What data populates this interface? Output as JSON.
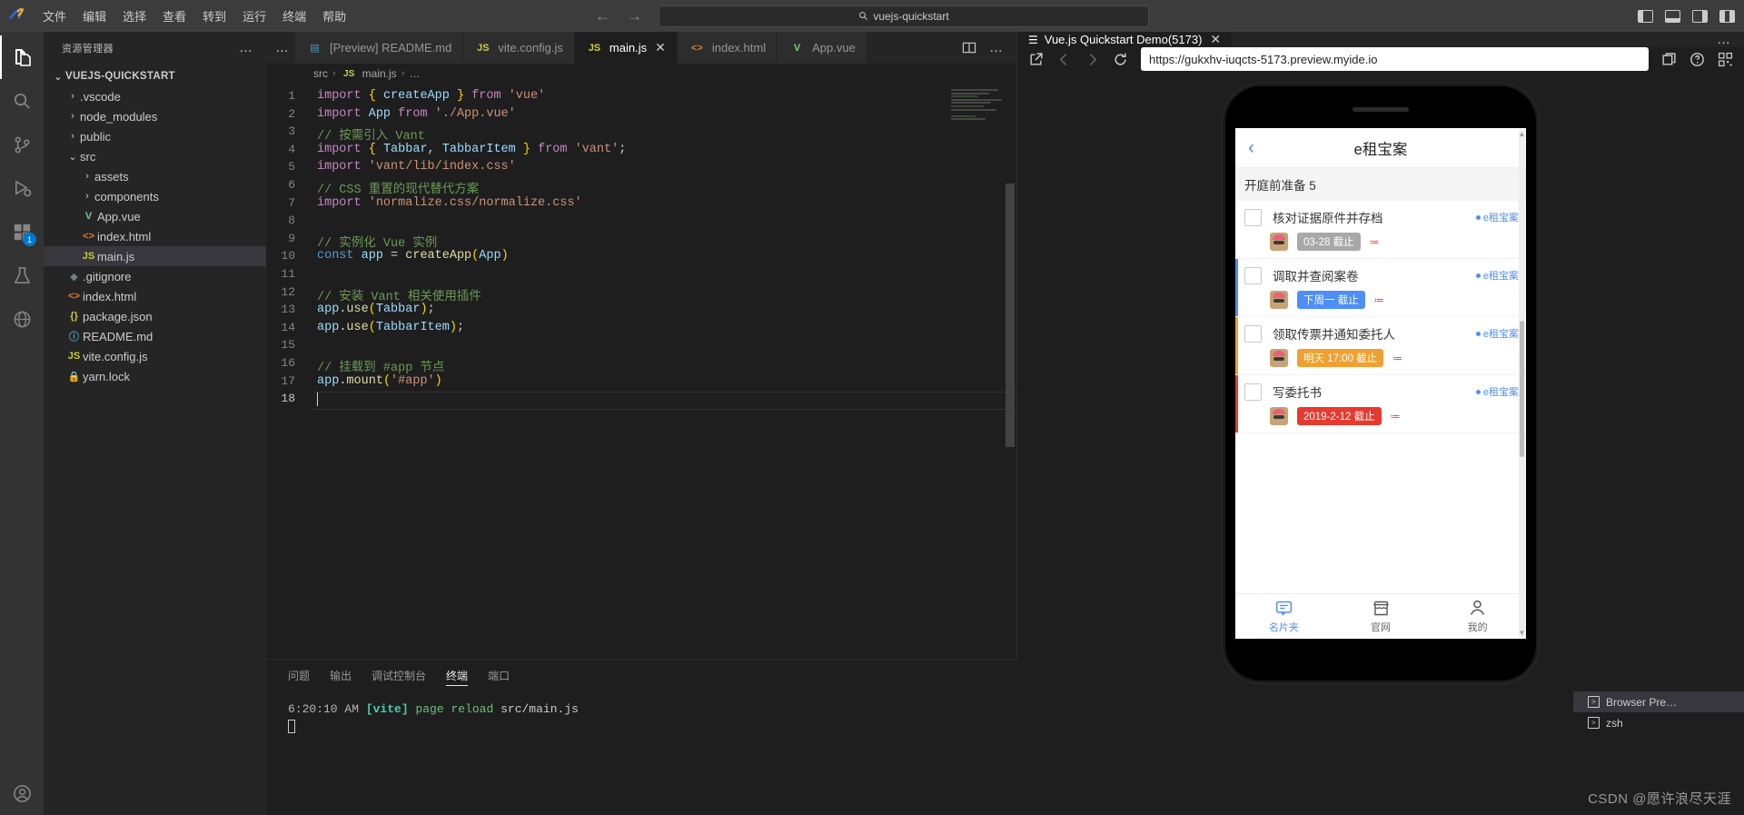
{
  "titlebar": {
    "menus": [
      "文件",
      "编辑",
      "选择",
      "查看",
      "转到",
      "运行",
      "终端",
      "帮助"
    ],
    "search_text": "vuejs-quickstart",
    "search_icon": "search-icon"
  },
  "activitybar": {
    "items": [
      {
        "name": "explorer",
        "icon": "files-icon",
        "badge": ""
      },
      {
        "name": "search",
        "icon": "search-icon",
        "badge": ""
      },
      {
        "name": "source-control",
        "icon": "source-control-icon",
        "badge": ""
      },
      {
        "name": "run-and-debug",
        "icon": "debug-icon",
        "badge": ""
      },
      {
        "name": "extensions",
        "icon": "extensions-icon",
        "badge": "1"
      },
      {
        "name": "testing",
        "icon": "beaker-icon",
        "badge": ""
      },
      {
        "name": "remote",
        "icon": "remote-icon",
        "badge": ""
      }
    ],
    "bottom": [
      {
        "name": "accounts",
        "icon": "account-icon"
      }
    ]
  },
  "explorer": {
    "title": "资源管理器",
    "more_label": "…",
    "root": "VUEJS-QUICKSTART",
    "items": [
      {
        "label": ".vscode",
        "icon": "folder",
        "kind": "folder",
        "indent": 1,
        "expanded": false
      },
      {
        "label": "node_modules",
        "icon": "folder",
        "kind": "folder",
        "indent": 1,
        "expanded": false
      },
      {
        "label": "public",
        "icon": "folder",
        "kind": "folder",
        "indent": 1,
        "expanded": false
      },
      {
        "label": "src",
        "icon": "folder",
        "kind": "folder",
        "indent": 1,
        "expanded": true
      },
      {
        "label": "assets",
        "icon": "folder",
        "kind": "folder",
        "indent": 2,
        "expanded": false
      },
      {
        "label": "components",
        "icon": "folder",
        "kind": "folder",
        "indent": 2,
        "expanded": false
      },
      {
        "label": "App.vue",
        "icon": "vue",
        "kind": "file",
        "indent": 2
      },
      {
        "label": "index.html",
        "icon": "html",
        "kind": "file",
        "indent": 2
      },
      {
        "label": "main.js",
        "icon": "js",
        "kind": "file",
        "indent": 2,
        "selected": true
      },
      {
        "label": ".gitignore",
        "icon": "git",
        "kind": "file",
        "indent": 1
      },
      {
        "label": "index.html",
        "icon": "html",
        "kind": "file",
        "indent": 1
      },
      {
        "label": "package.json",
        "icon": "json",
        "kind": "file",
        "indent": 1
      },
      {
        "label": "README.md",
        "icon": "md",
        "kind": "file",
        "indent": 1
      },
      {
        "label": "vite.config.js",
        "icon": "js",
        "kind": "file",
        "indent": 1
      },
      {
        "label": "yarn.lock",
        "icon": "lock",
        "kind": "file",
        "indent": 1
      }
    ]
  },
  "editor": {
    "tabs": [
      {
        "label": "[Preview] README.md",
        "icon": "preview-icon",
        "active": false,
        "closable": false
      },
      {
        "label": "vite.config.js",
        "icon": "js-icon",
        "active": false,
        "closable": false
      },
      {
        "label": "main.js",
        "icon": "js-icon",
        "active": true,
        "closable": true
      },
      {
        "label": "index.html",
        "icon": "html-icon",
        "active": false,
        "closable": false
      },
      {
        "label": "App.vue",
        "icon": "vue-icon",
        "active": false,
        "closable": false
      }
    ],
    "tab_close_label": "✕",
    "actions": {
      "split_label": "split-editor-icon",
      "more_label": "…"
    },
    "breadcrumb": [
      "src",
      "main.js",
      "…"
    ],
    "breadcrumb_file_icon": "js-icon",
    "line_numbers": [
      1,
      2,
      3,
      4,
      5,
      6,
      7,
      8,
      9,
      10,
      11,
      12,
      13,
      14,
      15,
      16,
      17,
      18
    ],
    "current_line": 18,
    "lines": [
      [
        [
          "tk-kw",
          "import"
        ],
        [
          "tk-pl",
          " "
        ],
        [
          "tk-br",
          "{"
        ],
        [
          "tk-pl",
          " "
        ],
        [
          "tk-var",
          "createApp"
        ],
        [
          "tk-pl",
          " "
        ],
        [
          "tk-br",
          "}"
        ],
        [
          "tk-pl",
          " "
        ],
        [
          "tk-kw",
          "from"
        ],
        [
          "tk-pl",
          " "
        ],
        [
          "tk-str",
          "'vue'"
        ]
      ],
      [
        [
          "tk-kw",
          "import"
        ],
        [
          "tk-pl",
          " "
        ],
        [
          "tk-var",
          "App"
        ],
        [
          "tk-pl",
          " "
        ],
        [
          "tk-kw",
          "from"
        ],
        [
          "tk-pl",
          " "
        ],
        [
          "tk-str",
          "'./App.vue'"
        ]
      ],
      [
        [
          "tk-cmt",
          "// 按需引入 Vant"
        ]
      ],
      [
        [
          "tk-kw",
          "import"
        ],
        [
          "tk-pl",
          " "
        ],
        [
          "tk-br",
          "{"
        ],
        [
          "tk-pl",
          " "
        ],
        [
          "tk-var",
          "Tabbar"
        ],
        [
          "tk-pl",
          ", "
        ],
        [
          "tk-var",
          "TabbarItem"
        ],
        [
          "tk-pl",
          " "
        ],
        [
          "tk-br",
          "}"
        ],
        [
          "tk-pl",
          " "
        ],
        [
          "tk-kw",
          "from"
        ],
        [
          "tk-pl",
          " "
        ],
        [
          "tk-str",
          "'vant'"
        ],
        [
          "tk-pl",
          ";"
        ]
      ],
      [
        [
          "tk-kw",
          "import"
        ],
        [
          "tk-pl",
          " "
        ],
        [
          "tk-str",
          "'vant/lib/index.css'"
        ]
      ],
      [
        [
          "tk-cmt",
          "// CSS 重置的现代替代方案"
        ]
      ],
      [
        [
          "tk-kw",
          "import"
        ],
        [
          "tk-pl",
          " "
        ],
        [
          "tk-str",
          "'normalize.css/normalize.css'"
        ]
      ],
      [],
      [
        [
          "tk-cmt",
          "// 实例化 Vue 实例"
        ]
      ],
      [
        [
          "tk-kw2",
          "const"
        ],
        [
          "tk-pl",
          " "
        ],
        [
          "tk-var",
          "app"
        ],
        [
          "tk-pl",
          " = "
        ],
        [
          "tk-fn",
          "createApp"
        ],
        [
          "tk-br",
          "("
        ],
        [
          "tk-var",
          "App"
        ],
        [
          "tk-br",
          ")"
        ]
      ],
      [],
      [
        [
          "tk-cmt",
          "// 安装 Vant 相关使用插件"
        ]
      ],
      [
        [
          "tk-var",
          "app"
        ],
        [
          "tk-pl",
          "."
        ],
        [
          "tk-fn",
          "use"
        ],
        [
          "tk-br",
          "("
        ],
        [
          "tk-var",
          "Tabbar"
        ],
        [
          "tk-br",
          ")"
        ],
        [
          "tk-pl",
          ";"
        ]
      ],
      [
        [
          "tk-var",
          "app"
        ],
        [
          "tk-pl",
          "."
        ],
        [
          "tk-fn",
          "use"
        ],
        [
          "tk-br",
          "("
        ],
        [
          "tk-var",
          "TabbarItem"
        ],
        [
          "tk-br",
          ")"
        ],
        [
          "tk-pl",
          ";"
        ]
      ],
      [],
      [
        [
          "tk-cmt",
          "// 挂载到 #app 节点"
        ]
      ],
      [
        [
          "tk-var",
          "app"
        ],
        [
          "tk-pl",
          "."
        ],
        [
          "tk-fn",
          "mount"
        ],
        [
          "tk-br",
          "("
        ],
        [
          "tk-str",
          "'#app'"
        ],
        [
          "tk-br",
          ")"
        ]
      ],
      []
    ]
  },
  "preview": {
    "tab_label": "Vue.js Quickstart Demo(5173)",
    "tab_icon": "preview-list-icon",
    "tab_close_label": "✕",
    "more_label": "…",
    "url": "https://gukxhv-iuqcts-5173.preview.myide.io",
    "toolbar": {
      "open_external": "open-external-icon",
      "back": "back-arrow-icon",
      "forward": "forward-arrow-icon",
      "reload": "reload-icon",
      "devtools": "devtools-icon",
      "help": "help-icon",
      "qr": "qr-code-icon"
    },
    "phone": {
      "nav_back": "‹",
      "nav_title": "e租宝案",
      "section_title": "开庭前准备 5",
      "todos": [
        {
          "text": "核对证据原件并存档",
          "case": "e租宝案",
          "due": "03-28 截止",
          "due_style": "due-grey",
          "bar": "transparent"
        },
        {
          "text": "调取并查阅案卷",
          "case": "e租宝案",
          "due": "下周一 截止",
          "due_style": "due-blue",
          "bar": "#4e8ef7"
        },
        {
          "text": "领取传票并通知委托人",
          "case": "e租宝案",
          "due": "明天 17:00 截止",
          "due_style": "due-orange",
          "bar": "#f0a030"
        },
        {
          "text": "写委托书",
          "case": "e租宝案",
          "due": "2019-2-12 截止",
          "due_style": "due-red",
          "bar": "#e8392f"
        }
      ],
      "tabbar": [
        {
          "label": "名片夹",
          "icon": "card-holder-icon",
          "active": true
        },
        {
          "label": "官网",
          "icon": "store-icon",
          "active": false
        },
        {
          "label": "我的",
          "icon": "person-icon",
          "active": false
        }
      ]
    }
  },
  "panel": {
    "tabs": [
      {
        "label": "问题",
        "active": false
      },
      {
        "label": "输出",
        "active": false
      },
      {
        "label": "调试控制台",
        "active": false
      },
      {
        "label": "终端",
        "active": true
      },
      {
        "label": "端口",
        "active": false
      }
    ],
    "terminal": {
      "time": "6:20:10 AM",
      "tag": "[vite]",
      "message": "page reload",
      "file": "src/main.js"
    },
    "tools": {
      "new_terminal": "+",
      "split_dropdown": "⌄",
      "more": "…",
      "maximize": "⌃",
      "close": "✕"
    },
    "terminal_list": [
      {
        "label": "Browser Pre…",
        "icon": "terminal-icon",
        "active": true
      },
      {
        "label": "zsh",
        "icon": "terminal-icon",
        "active": false
      }
    ]
  },
  "watermark": "CSDN @愿许浪尽天涯"
}
